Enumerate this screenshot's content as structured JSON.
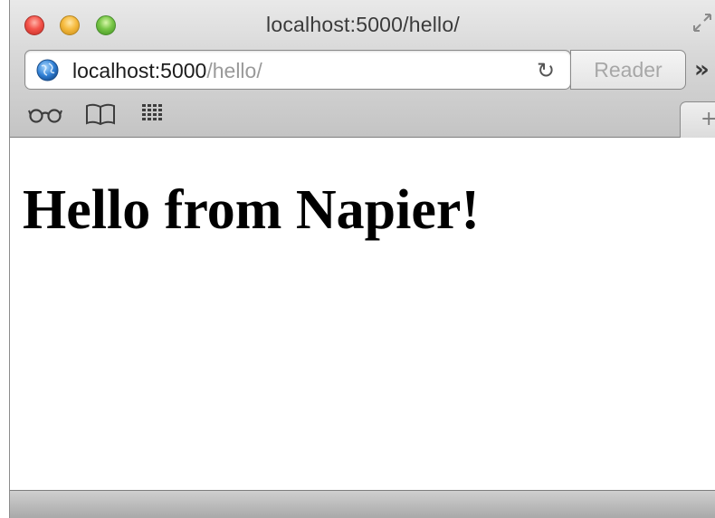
{
  "window": {
    "title": "localhost:5000/hello/"
  },
  "toolbar": {
    "address": {
      "host": "localhost:5000",
      "path": "/hello/"
    },
    "reader_label": "Reader",
    "overflow_glyph": "»",
    "reload_glyph": "↻",
    "newtab_glyph": "+"
  },
  "bookmarks_bar": {
    "icons": [
      "reading-list-icon",
      "bookmarks-icon",
      "top-sites-icon"
    ]
  },
  "page": {
    "heading": "Hello from Napier!"
  },
  "colors": {
    "close": "#f4544b",
    "minimize": "#f6bb3f",
    "maximize": "#78c646",
    "url_path": "#9a9a9a"
  }
}
